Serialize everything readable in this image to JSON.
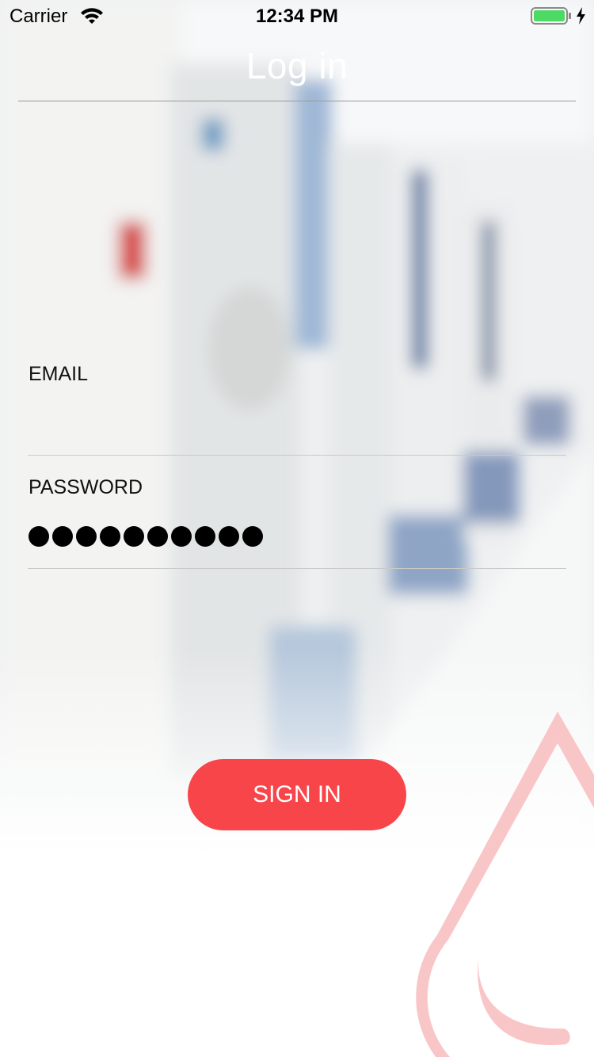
{
  "status_bar": {
    "carrier": "Carrier",
    "time": "12:34 PM",
    "icons": [
      "wifi-icon",
      "battery-icon",
      "charging-bolt-icon"
    ],
    "battery_color": "#4cd964"
  },
  "header": {
    "title": "Log in"
  },
  "form": {
    "email": {
      "label": "EMAIL",
      "value": ""
    },
    "password": {
      "label": "PASSWORD",
      "masked_length": 10
    }
  },
  "actions": {
    "sign_in_label": "SIGN IN"
  },
  "colors": {
    "accent": "#f84549",
    "drop": "#f9c6c8"
  },
  "decor": {
    "icon": "blood-drop-icon"
  }
}
